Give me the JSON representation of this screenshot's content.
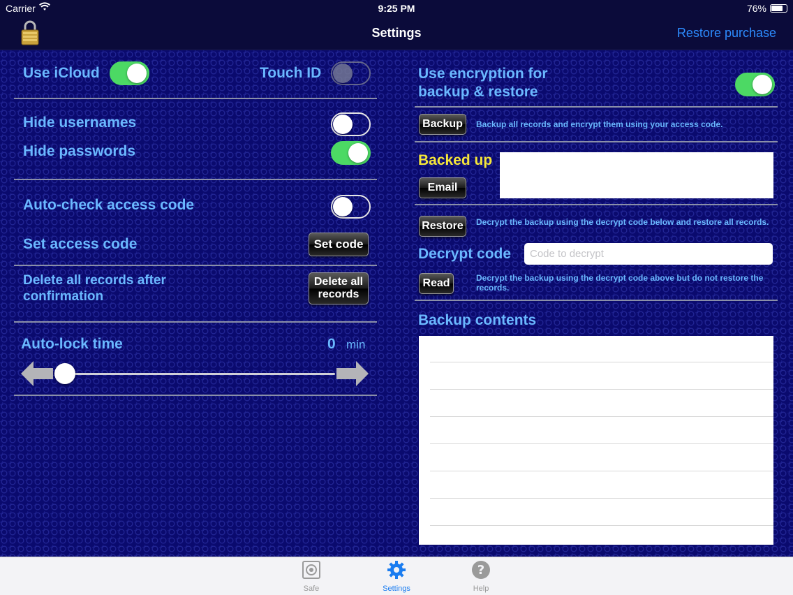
{
  "status_bar": {
    "carrier": "Carrier",
    "time": "9:25 PM",
    "battery_percent": "76%",
    "battery_level": 0.76
  },
  "nav": {
    "title": "Settings",
    "restore_purchase": "Restore purchase"
  },
  "left": {
    "use_icloud": {
      "label": "Use iCloud",
      "on": true
    },
    "touch_id": {
      "label": "Touch ID",
      "on": false,
      "enabled": false
    },
    "hide_usernames": {
      "label": "Hide usernames",
      "on": false
    },
    "hide_passwords": {
      "label": "Hide passwords",
      "on": true
    },
    "auto_check": {
      "label": "Auto-check access code",
      "on": false
    },
    "set_access_code": {
      "label": "Set access code",
      "button": "Set code"
    },
    "delete_all": {
      "label_line1": "Delete all records after",
      "label_line2": "confirmation",
      "button_line1": "Delete all",
      "button_line2": "records"
    },
    "auto_lock": {
      "label": "Auto-lock time",
      "value": "0",
      "unit": "min",
      "slider_fraction": 0.0
    }
  },
  "right": {
    "encryption": {
      "label_line1": "Use encryption for",
      "label_line2": "backup & restore",
      "on": true
    },
    "backup": {
      "button": "Backup",
      "description": "Backup all records and encrypt them using your access code."
    },
    "backed_up": {
      "label": "Backed up",
      "email_button": "Email"
    },
    "restore": {
      "button": "Restore",
      "description": "Decrypt the backup using the decrypt code below and restore all records."
    },
    "decrypt_code": {
      "label": "Decrypt code",
      "placeholder": "Code to decrypt",
      "value": ""
    },
    "read": {
      "button": "Read",
      "description": "Decrypt the backup using the decrypt code above but do not restore the records."
    },
    "backup_contents": {
      "label": "Backup contents"
    }
  },
  "tabs": [
    {
      "label": "Safe",
      "icon": "safe-icon",
      "active": false
    },
    {
      "label": "Settings",
      "icon": "gear-icon",
      "active": true
    },
    {
      "label": "Help",
      "icon": "help-icon",
      "active": false
    }
  ],
  "colors": {
    "label_blue": "#6ab8ff",
    "toggle_green": "#4cd964",
    "highlight_yellow": "#f5e63a",
    "link_blue": "#2d8cff",
    "tab_active": "#1a7cf0"
  }
}
